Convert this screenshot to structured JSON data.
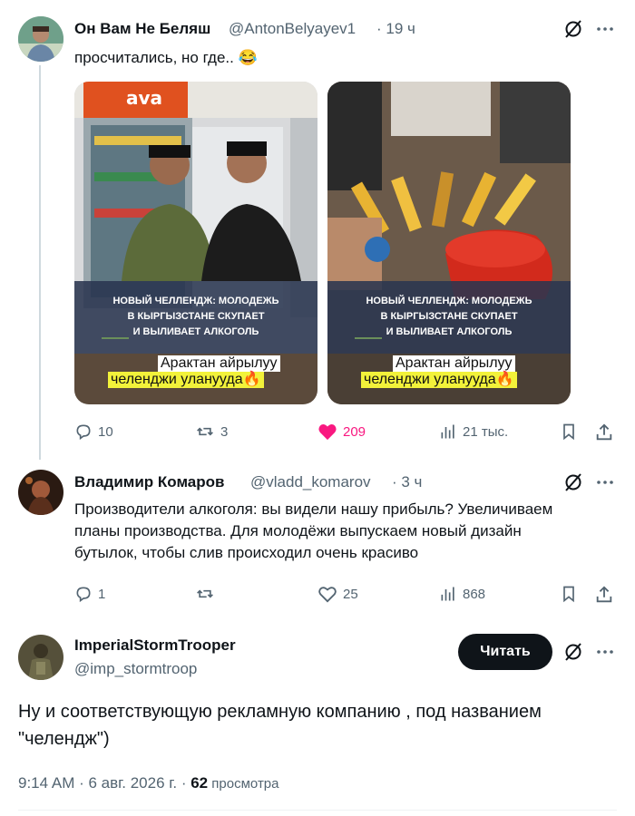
{
  "tweet1": {
    "author_name": "Он Вам Не Беляш",
    "author_handle": "@AntonBelyayev1",
    "time": "· 19 ч",
    "text": "просчитались, но где.. 😂",
    "image_left": {
      "logo_text": "ava",
      "caption_lines": [
        "НОВЫЙ ЧЕЛЛЕНДЖ: МОЛОДЕЖЬ",
        "В КЫРГЫЗСТАНЕ СКУПАЕТ",
        "И ВЫЛИВАЕТ АЛКОГОЛЬ"
      ],
      "sub1": "Арактан айрылуу",
      "sub2": "челенджи уланууда🔥"
    },
    "image_right": {
      "caption_lines": [
        "НОВЫЙ ЧЕЛЛЕНДЖ: МОЛОДЕЖЬ",
        "В КЫРГЫЗСТАНЕ СКУПАЕТ",
        "И ВЫЛИВАЕТ АЛКОГОЛЬ"
      ],
      "sub1": "Арактан айрылуу",
      "sub2": "челенджи уланууда🔥"
    },
    "replies": "10",
    "reposts": "3",
    "likes": "209",
    "views": "21 тыс.",
    "like_color": "#f91880"
  },
  "tweet2": {
    "author_name": "Владимир Комаров",
    "author_handle": "@vladd_komarov",
    "time": "· 3 ч",
    "text_lines": [
      "Производители алкоголя: вы видели нашу прибыль? Увеличиваем",
      "планы производства. Для молодёжи выпускаем новый дизайн",
      "бутылок, чтобы слив происходил очень красиво"
    ],
    "replies": "1",
    "reposts": "",
    "likes": "25",
    "views": "868"
  },
  "tweet3": {
    "author_name": "ImperialStormTrooper",
    "author_handle": "@imp_stormtroop",
    "follow_label": "Читать",
    "text_lines": [
      "Ну и соответствующую рекламную компанию , под названием",
      "\"челендж\")"
    ],
    "timestamp": "9:14 AM · 6 авг. 2026 г. · ",
    "views_count": "62",
    "views_label": " просмотра"
  },
  "icons": {
    "grok": "grok-icon",
    "more": "more-icon",
    "reply": "reply-icon",
    "repost": "repost-icon",
    "like": "heart-icon",
    "views": "views-icon",
    "bookmark": "bookmark-icon",
    "share": "share-icon"
  }
}
